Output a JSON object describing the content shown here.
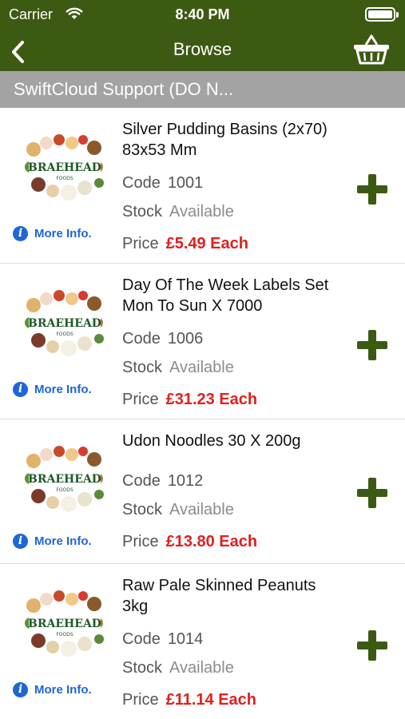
{
  "status_bar": {
    "carrier": "Carrier",
    "time": "8:40 PM"
  },
  "nav": {
    "title": "Browse",
    "back_icon": "chevron-left-icon",
    "basket_icon": "basket-icon"
  },
  "section": {
    "title": "SwiftCloud Support (DO N..."
  },
  "labels": {
    "code": "Code",
    "stock": "Stock",
    "price": "Price",
    "more_info": "More Info."
  },
  "colors": {
    "nav_bg": "#3d5a12",
    "section_bg": "#a3a3a3",
    "price": "#e0201e",
    "link": "#1e66d6",
    "add": "#3d5a12"
  },
  "products": [
    {
      "name": "Silver Pudding Basins (2x70) 83x53 Mm",
      "code": "1001",
      "stock": "Available",
      "price": "£5.49 Each",
      "logo": "BRAEHEAD",
      "logo_sub": "FOODS"
    },
    {
      "name": "Day Of The Week Labels Set Mon To Sun X 7000",
      "code": "1006",
      "stock": "Available",
      "price": "£31.23 Each",
      "logo": "BRAEHEAD",
      "logo_sub": "FOODS"
    },
    {
      "name": "Udon Noodles 30 X 200g",
      "code": "1012",
      "stock": "Available",
      "price": "£13.80 Each",
      "logo": "BRAEHEAD",
      "logo_sub": "FOODS"
    },
    {
      "name": "Raw Pale Skinned Peanuts 3kg",
      "code": "1014",
      "stock": "Available",
      "price": "£11.14 Each",
      "logo": "BRAEHEAD",
      "logo_sub": "FOODS"
    }
  ]
}
